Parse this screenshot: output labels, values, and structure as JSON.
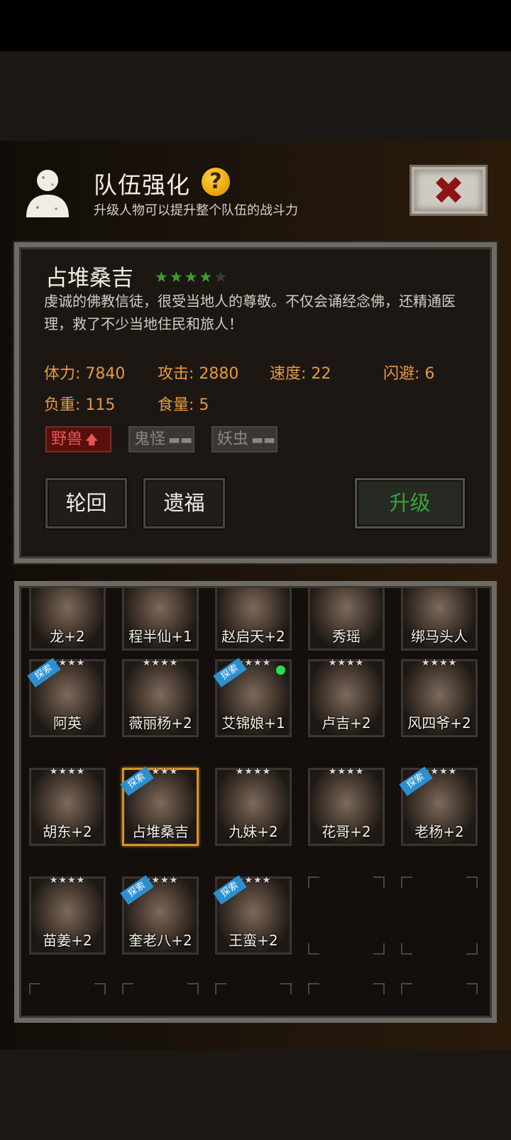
{
  "header": {
    "title": "队伍强化",
    "help_icon": "?",
    "subtitle": "升级人物可以提升整个队伍的战斗力",
    "close_icon": "✖"
  },
  "character": {
    "name": "占堆桑吉",
    "stars_on": "★★★★",
    "stars_off": "★",
    "description": "虔诚的佛教信徒，很受当地人的尊敬。不仅会诵经念佛，还精通医理，救了不少当地住民和旅人！",
    "stats": {
      "stamina": "体力: 7840",
      "attack": "攻击: 2880",
      "speed": "速度: 22",
      "dodge": "闪避: 6",
      "load": "负重: 115",
      "food": "食量: 5"
    },
    "tags": [
      {
        "label": "野兽",
        "symbol": "🡅"
      },
      {
        "label": "鬼怪",
        "symbol": "▬▬"
      },
      {
        "label": "妖虫",
        "symbol": "▬▬"
      }
    ],
    "buttons": {
      "reincarnate": "轮回",
      "legacy": "遗福",
      "upgrade": "升级"
    }
  },
  "roster": {
    "explore_label": "探索",
    "cards": [
      {
        "name": "龙+2",
        "stars": ""
      },
      {
        "name": "程半仙+1",
        "stars": ""
      },
      {
        "name": "赵启天+2",
        "stars": ""
      },
      {
        "name": "秀瑶",
        "stars": ""
      },
      {
        "name": "绑马头人",
        "stars": ""
      },
      {
        "name": "阿英",
        "stars": "★★★★"
      },
      {
        "name": "薇丽杨+2",
        "stars": "★★★★"
      },
      {
        "name": "艾锦娘+1",
        "stars": "★★★★"
      },
      {
        "name": "卢吉+2",
        "stars": "★★★★"
      },
      {
        "name": "风四爷+2",
        "stars": "★★★★"
      },
      {
        "name": "胡东+2",
        "stars": "★★★★"
      },
      {
        "name": "占堆桑吉",
        "stars": "★★★★"
      },
      {
        "name": "九妹+2",
        "stars": "★★★★"
      },
      {
        "name": "花哥+2",
        "stars": "★★★★"
      },
      {
        "name": "老杨+2",
        "stars": "★★★★"
      },
      {
        "name": "苗姜+2",
        "stars": "★★★★"
      },
      {
        "name": "奎老八+2",
        "stars": "★★★★"
      },
      {
        "name": "王蛮+2",
        "stars": "★★★★"
      }
    ]
  }
}
